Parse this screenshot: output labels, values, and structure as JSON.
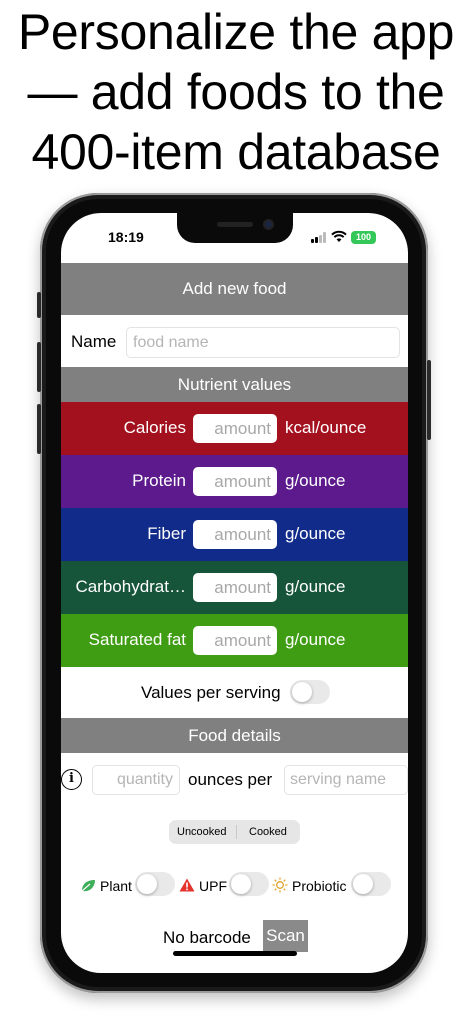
{
  "headline": {
    "line1": "Personalize the app",
    "line2": "— add foods to the",
    "line3": "400-item database"
  },
  "status_bar": {
    "time": "18:19",
    "battery": "100"
  },
  "add_food": {
    "title": "Add new food"
  },
  "name_row": {
    "label": "Name",
    "placeholder": "food name"
  },
  "nutrient_section": {
    "title": "Nutrient values",
    "rows": [
      {
        "label": "Calories",
        "placeholder": "amount",
        "unit": "kcal/ounce",
        "color": "#a3101e"
      },
      {
        "label": "Protein",
        "placeholder": "amount",
        "unit": "g/ounce",
        "color": "#5c1a8c"
      },
      {
        "label": "Fiber",
        "placeholder": "amount",
        "unit": "g/ounce",
        "color": "#102b8a"
      },
      {
        "label": "Carbohydrat…",
        "placeholder": "amount",
        "unit": "g/ounce",
        "color": "#17553a"
      },
      {
        "label": "Saturated fat",
        "placeholder": "amount",
        "unit": "g/ounce",
        "color": "#3f9d13"
      }
    ],
    "per_serving_label": "Values per serving",
    "per_serving_on": false
  },
  "food_details": {
    "title": "Food details",
    "quantity_placeholder": "quantity",
    "ounces_per_label": "ounces per",
    "serving_placeholder": "serving name",
    "segments": [
      "Uncooked",
      "Cooked"
    ],
    "flags": [
      {
        "label": "Plant",
        "icon": "leaf-icon",
        "on": false
      },
      {
        "label": "UPF",
        "icon": "warning-icon",
        "on": false
      },
      {
        "label": "Probiotic",
        "icon": "sun-icon",
        "on": false
      }
    ],
    "barcode_label": "No barcode",
    "scan_label": "Scan"
  }
}
